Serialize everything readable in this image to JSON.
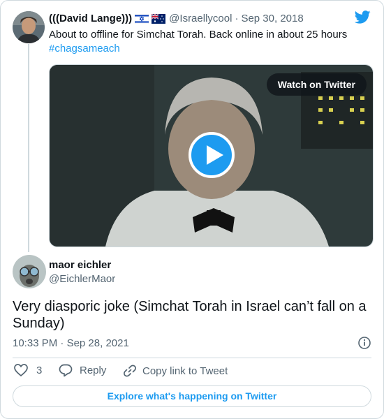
{
  "parent_tweet": {
    "author_name": "(((David Lange)))",
    "handle": "@Israellycool",
    "separator": "·",
    "date": "Sep 30, 2018",
    "text": "About to offline for Simchat Torah. Back online in about 25 hours",
    "hashtag": "#chagsameach",
    "flags": [
      "israel-flag-icon",
      "australia-flag-icon"
    ],
    "media": {
      "watch_label": "Watch on Twitter"
    }
  },
  "reply_tweet": {
    "author_name": "maor eichler",
    "handle": "@EichlerMaor",
    "text": "Very diasporic joke (Simchat Torah in Israel can’t fall on a Sunday)",
    "time": "10:33 PM",
    "separator": "·",
    "date": "Sep 28, 2021"
  },
  "actions": {
    "like_count": "3",
    "reply_label": "Reply",
    "copy_link_label": "Copy link to Tweet"
  },
  "footer": {
    "explore_label": "Explore what's happening on Twitter"
  },
  "colors": {
    "accent": "#1d9bf0",
    "muted": "#536471",
    "border": "#cfd9de"
  }
}
